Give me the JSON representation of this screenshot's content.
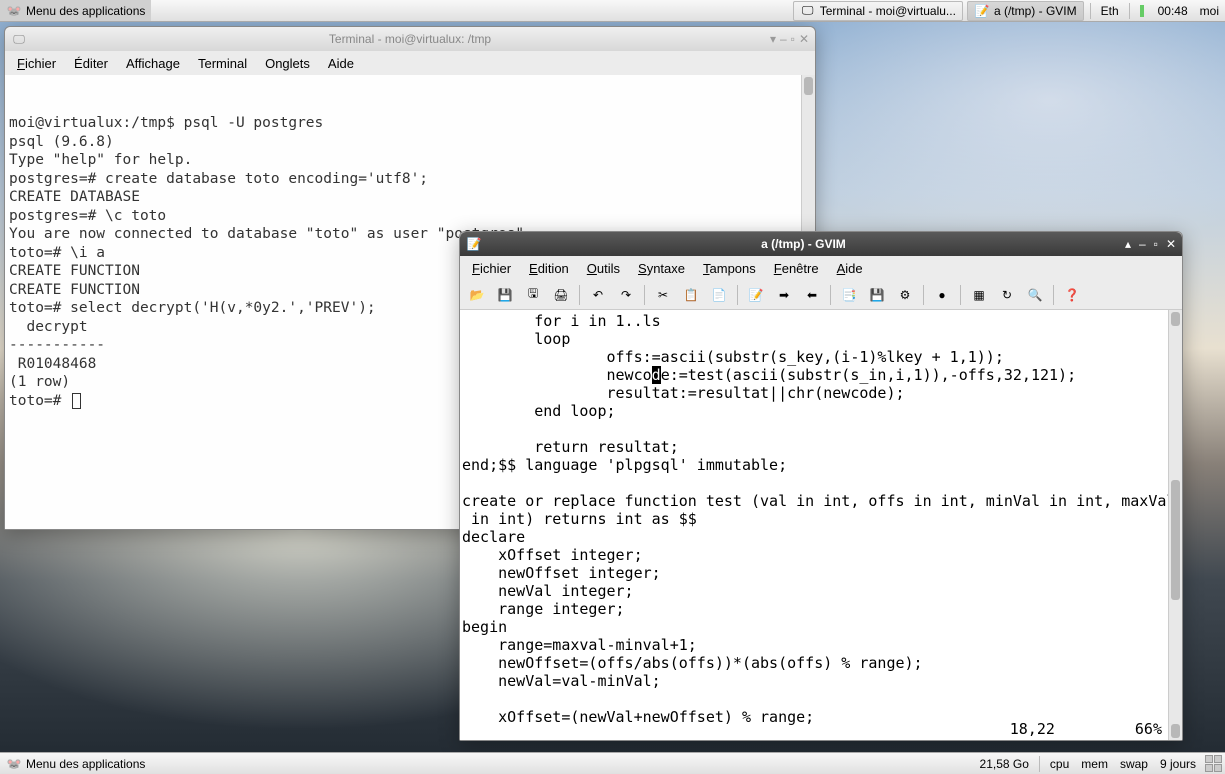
{
  "panel_top": {
    "app_menu": "Menu des applications",
    "tasks": [
      {
        "label": "Terminal - moi@virtualu...",
        "icon": "terminal"
      },
      {
        "label": "a (/tmp) - GVIM",
        "icon": "gvim"
      }
    ],
    "net": "Eth",
    "clock": "00:48",
    "user": "moi"
  },
  "panel_bottom": {
    "app_menu": "Menu des applications",
    "disk": "21,58 Go",
    "cpu": "cpu",
    "mem": "mem",
    "swap": "swap",
    "uptime": "9 jours"
  },
  "terminal": {
    "title": "Terminal - moi@virtualux: /tmp",
    "menus": [
      "Fichier",
      "Éditer",
      "Affichage",
      "Terminal",
      "Onglets",
      "Aide"
    ],
    "lines": [
      "moi@virtualux:/tmp$ psql -U postgres",
      "psql (9.6.8)",
      "Type \"help\" for help.",
      "",
      "postgres=# create database toto encoding='utf8';",
      "CREATE DATABASE",
      "postgres=# \\c toto",
      "You are now connected to database \"toto\" as user \"postgres\".",
      "toto=# \\i a",
      "CREATE FUNCTION",
      "CREATE FUNCTION",
      "toto=# select decrypt('H(v,*0y2.','PREV');",
      "  decrypt",
      "-----------",
      " R01048468",
      "(1 row)",
      "",
      "toto=# "
    ]
  },
  "gvim": {
    "title": "a (/tmp) - GVIM",
    "menus": [
      "Fichier",
      "Edition",
      "Outils",
      "Syntaxe",
      "Tampons",
      "Fenêtre",
      "Aide"
    ],
    "toolbar_icons": [
      "open",
      "save",
      "saveall",
      "print",
      "undo",
      "redo",
      "cut",
      "copy",
      "paste",
      "paste2",
      "arrow-right",
      "arrow-left",
      "copy2",
      "savedisk",
      "gears",
      "ball",
      "table",
      "refresh",
      "find",
      "help"
    ],
    "code_lines": [
      "        for i in 1..ls",
      "        loop",
      "                offs:=ascii(substr(s_key,(i-1)%lkey + 1,1));",
      "                newco|d|e:=test(ascii(substr(s_in,i,1)),-offs,32,121);",
      "                resultat:=resultat||chr(newcode);",
      "        end loop;",
      "",
      "        return resultat;",
      "end;$$ language 'plpgsql' immutable;",
      "",
      "create or replace function test (val in int, offs in int, minVal in int, maxVal",
      " in int) returns int as $$",
      "declare",
      "    xOffset integer;",
      "    newOffset integer;",
      "    newVal integer;",
      "    range integer;",
      "begin",
      "    range=maxval-minval+1;",
      "    newOffset=(offs/abs(offs))*(abs(offs) % range);",
      "    newVal=val-minVal;",
      "",
      "    xOffset=(newVal+newOffset) % range;"
    ],
    "status_pos": "18,22",
    "status_pct": "66%"
  }
}
